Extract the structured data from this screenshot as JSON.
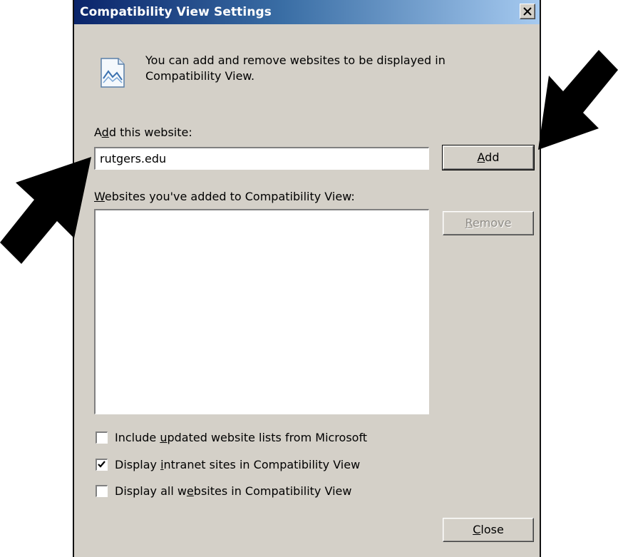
{
  "window": {
    "title": "Compatibility View Settings",
    "close_glyph": "✕"
  },
  "info": {
    "icon": "webpage-broken-icon",
    "text_line1": "You can add and remove websites to be displayed in",
    "text_line2": "Compatibility View."
  },
  "add_site": {
    "label_pre": "A",
    "label_accel": "d",
    "label_post": "d this website:",
    "value": "rutgers.edu"
  },
  "add_button": {
    "accel": "A",
    "rest": "dd"
  },
  "list": {
    "label_accel": "W",
    "label_post": "ebsites you've added to Compatibility View:",
    "items": []
  },
  "remove_button": {
    "accel": "R",
    "rest": "emove",
    "enabled": false
  },
  "options": [
    {
      "pre": "Include ",
      "accel": "u",
      "post": "pdated website lists from Microsoft",
      "checked": false
    },
    {
      "pre": "Display ",
      "accel": "i",
      "post": "ntranet sites in Compatibility View",
      "checked": true
    },
    {
      "pre": "Display all w",
      "accel": "e",
      "post": "bsites in Compatibility View",
      "checked": false
    }
  ],
  "close_button": {
    "accel": "C",
    "rest": "lose"
  },
  "colors": {
    "dialog_bg": "#d4d0c8",
    "title_start": "#0a246a",
    "title_end": "#a6caf0",
    "arrow": "#000000"
  }
}
